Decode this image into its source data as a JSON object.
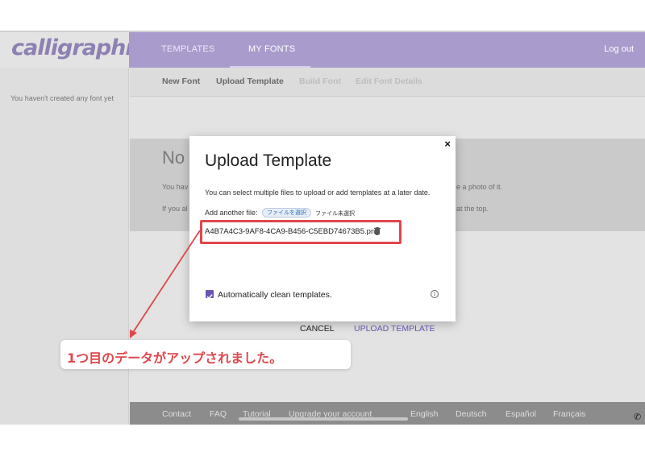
{
  "app": {
    "logo": "calligraphr",
    "nav": {
      "templates": "TEMPLATES",
      "my_fonts": "MY FONTS",
      "logout": "Log out"
    },
    "subnav": [
      "New Font",
      "Upload Template",
      "Build Font",
      "Edit Font Details"
    ]
  },
  "sidebar": {
    "empty_text": "You haven't created any font yet"
  },
  "main": {
    "heading": "No",
    "line1_start": "You hav",
    "line1_end": "e a photo of it.",
    "line2_start": "If you al",
    "line2_end": "at the top."
  },
  "modal": {
    "title": "Upload Template",
    "description": "You can select multiple files to upload or add templates at a later date.",
    "file_label": "Add another file:",
    "file_button": "ファイルを選択",
    "file_status": "ファイル未選択",
    "file_name": "A4B7A4C3-9AF8-4CA9-B456-C5EBD74673B5.png",
    "checkbox_label": "Automatically clean templates.",
    "checkbox_checked": true,
    "cancel": "CANCEL",
    "upload": "UPLOAD TEMPLATE",
    "close": "×"
  },
  "footer": [
    "Contact",
    "FAQ",
    "Tutorial",
    "Upgrade your account",
    "English",
    "Deutsch",
    "Español",
    "Français"
  ],
  "annotation": {
    "text": "1つ目のデータがアップされました。",
    "color": "#e0474c"
  },
  "colors": {
    "accent": "#a99ccc",
    "button_accent": "#6a55b0",
    "highlight": "#e0474c"
  }
}
